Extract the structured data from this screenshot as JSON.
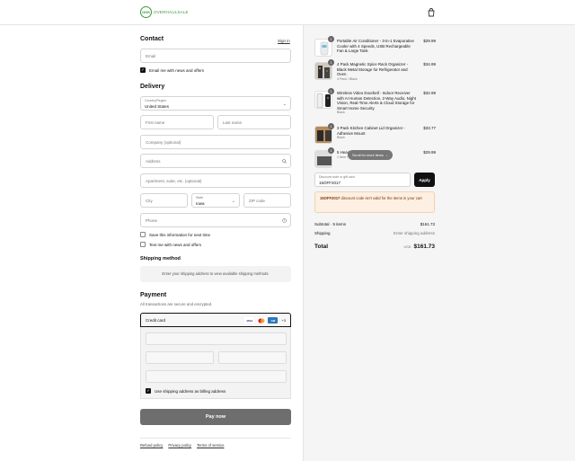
{
  "header": {
    "logo_badge": "OHS",
    "logo_text": "OVERHAULSALE",
    "cart_icon": "bag-icon"
  },
  "contact": {
    "title": "Contact",
    "sign_in": "Sign in",
    "email_placeholder": "Email",
    "news_label": "Email me with news and offers"
  },
  "delivery": {
    "title": "Delivery",
    "country_label": "Country/Region",
    "country_value": "United States",
    "first_name": "First name",
    "last_name": "Last name",
    "company": "Company (optional)",
    "address": "Address",
    "apartment": "Apartment, suite, etc. (optional)",
    "city": "City",
    "state_label": "State",
    "state_value": "Iowa",
    "zip": "ZIP code",
    "phone": "Phone",
    "save_info": "Save this information for next time",
    "text_news": "Text me with news and offers"
  },
  "shipping": {
    "title": "Shipping method",
    "info": "Enter your shipping address to view available shipping methods."
  },
  "payment": {
    "title": "Payment",
    "subtitle": "All transactions are secure and encrypted.",
    "credit_card": "Credit card",
    "more_cards": "+3",
    "billing_same": "Use shipping address as billing address",
    "pay_now": "Pay now"
  },
  "footer": {
    "links": [
      "Refund policy",
      "Privacy policy",
      "Terms of service"
    ]
  },
  "cart": {
    "items": [
      {
        "qty": "1",
        "name": "Portable Air Conditioner - 3-in-1 Evaporative Cooler with 4 Speeds, USB Rechargeable Fan & Large Tank",
        "variant": "",
        "price": "$29.99"
      },
      {
        "qty": "1",
        "name": "4 Pack Magnetic Spice Rack Organizer - Black Metal Storage for Refrigerator and Oven",
        "variant": "4 Pack / Black",
        "price": "$34.99"
      },
      {
        "qty": "1",
        "name": "Wireless Video Doorbell - Indoor Receiver with AI Human Detection, 2-Way Audio, Night Vision, Real-Time Alerts & Cloud Storage for Smart Home Security",
        "variant": "Black",
        "price": "$32.99"
      },
      {
        "qty": "1",
        "name": "3 Pack Kitchen Cabinet Lid Organizer - Adhesive Mount",
        "variant": "Black",
        "price": "$33.77"
      },
      {
        "qty": "1",
        "name": "5 Head...",
        "variant": "1 Item / Wireless / Audio / Face / ...",
        "price": "$29.99"
      }
    ],
    "scroll_hint": "Scroll for more items",
    "discount_label": "Discount code or gift card",
    "discount_value": "15OFF2017",
    "apply": "Apply",
    "error_code": "15OFF2017",
    "error_text": " discount code isn't valid for the items in your cart",
    "subtotal_label": "Subtotal · 5 items",
    "subtotal_value": "$161.73",
    "shipping_label": "Shipping",
    "shipping_value": "Enter shipping address",
    "total_label": "Total",
    "currency": "USD",
    "total_value": "$161.73"
  }
}
